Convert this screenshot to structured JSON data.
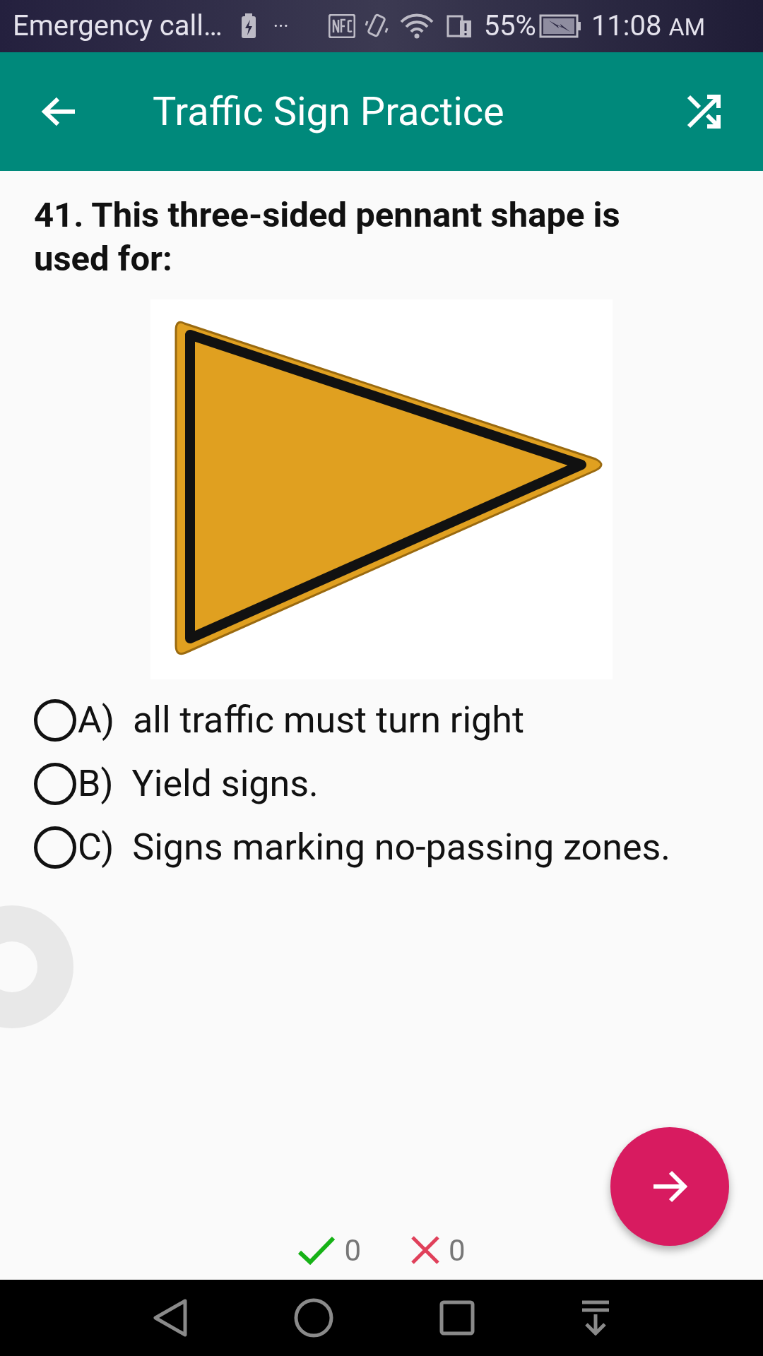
{
  "status_bar": {
    "notification": "Emergency call…",
    "overflow": "···",
    "battery_percent": "55%",
    "time": "11:08",
    "time_suffix": "AM"
  },
  "app_bar": {
    "title": "Traffic Sign Practice"
  },
  "question": {
    "text": "41. This three-sided pennant shape is used for:"
  },
  "options": [
    {
      "letter": "A)",
      "text": "all traffic must turn right",
      "selected": false
    },
    {
      "letter": "B)",
      "text": "Yield signs.",
      "selected": false
    },
    {
      "letter": "C)",
      "text": "Signs marking no-passing zones.",
      "selected": false
    }
  ],
  "score": {
    "correct": "0",
    "wrong": "0"
  }
}
